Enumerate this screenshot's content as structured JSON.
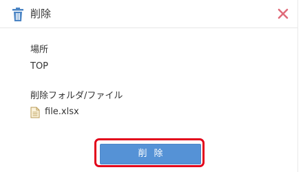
{
  "dialog": {
    "title": "削除",
    "title_icon": "trash-icon",
    "close_icon": "close-icon"
  },
  "location": {
    "label": "場所",
    "value": "TOP"
  },
  "items": {
    "label": "削除フォルダ/ファイル",
    "files": [
      {
        "name": "file.xlsx",
        "icon": "file-icon"
      }
    ]
  },
  "actions": {
    "delete_label": "削除"
  },
  "colors": {
    "accent": "#5592d6",
    "close": "#e06b7a",
    "trash_icon": "#4a84c4",
    "highlight": "#e2001a"
  }
}
